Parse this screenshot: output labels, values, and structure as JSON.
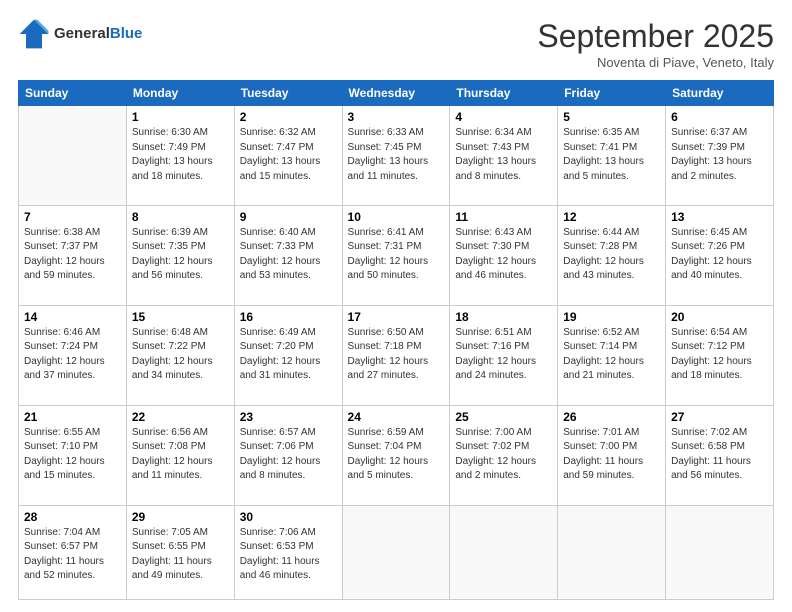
{
  "header": {
    "logo_line1": "General",
    "logo_line2": "Blue",
    "month": "September 2025",
    "location": "Noventa di Piave, Veneto, Italy"
  },
  "weekdays": [
    "Sunday",
    "Monday",
    "Tuesday",
    "Wednesday",
    "Thursday",
    "Friday",
    "Saturday"
  ],
  "weeks": [
    [
      {
        "day": "",
        "info": ""
      },
      {
        "day": "1",
        "info": "Sunrise: 6:30 AM\nSunset: 7:49 PM\nDaylight: 13 hours\nand 18 minutes."
      },
      {
        "day": "2",
        "info": "Sunrise: 6:32 AM\nSunset: 7:47 PM\nDaylight: 13 hours\nand 15 minutes."
      },
      {
        "day": "3",
        "info": "Sunrise: 6:33 AM\nSunset: 7:45 PM\nDaylight: 13 hours\nand 11 minutes."
      },
      {
        "day": "4",
        "info": "Sunrise: 6:34 AM\nSunset: 7:43 PM\nDaylight: 13 hours\nand 8 minutes."
      },
      {
        "day": "5",
        "info": "Sunrise: 6:35 AM\nSunset: 7:41 PM\nDaylight: 13 hours\nand 5 minutes."
      },
      {
        "day": "6",
        "info": "Sunrise: 6:37 AM\nSunset: 7:39 PM\nDaylight: 13 hours\nand 2 minutes."
      }
    ],
    [
      {
        "day": "7",
        "info": "Sunrise: 6:38 AM\nSunset: 7:37 PM\nDaylight: 12 hours\nand 59 minutes."
      },
      {
        "day": "8",
        "info": "Sunrise: 6:39 AM\nSunset: 7:35 PM\nDaylight: 12 hours\nand 56 minutes."
      },
      {
        "day": "9",
        "info": "Sunrise: 6:40 AM\nSunset: 7:33 PM\nDaylight: 12 hours\nand 53 minutes."
      },
      {
        "day": "10",
        "info": "Sunrise: 6:41 AM\nSunset: 7:31 PM\nDaylight: 12 hours\nand 50 minutes."
      },
      {
        "day": "11",
        "info": "Sunrise: 6:43 AM\nSunset: 7:30 PM\nDaylight: 12 hours\nand 46 minutes."
      },
      {
        "day": "12",
        "info": "Sunrise: 6:44 AM\nSunset: 7:28 PM\nDaylight: 12 hours\nand 43 minutes."
      },
      {
        "day": "13",
        "info": "Sunrise: 6:45 AM\nSunset: 7:26 PM\nDaylight: 12 hours\nand 40 minutes."
      }
    ],
    [
      {
        "day": "14",
        "info": "Sunrise: 6:46 AM\nSunset: 7:24 PM\nDaylight: 12 hours\nand 37 minutes."
      },
      {
        "day": "15",
        "info": "Sunrise: 6:48 AM\nSunset: 7:22 PM\nDaylight: 12 hours\nand 34 minutes."
      },
      {
        "day": "16",
        "info": "Sunrise: 6:49 AM\nSunset: 7:20 PM\nDaylight: 12 hours\nand 31 minutes."
      },
      {
        "day": "17",
        "info": "Sunrise: 6:50 AM\nSunset: 7:18 PM\nDaylight: 12 hours\nand 27 minutes."
      },
      {
        "day": "18",
        "info": "Sunrise: 6:51 AM\nSunset: 7:16 PM\nDaylight: 12 hours\nand 24 minutes."
      },
      {
        "day": "19",
        "info": "Sunrise: 6:52 AM\nSunset: 7:14 PM\nDaylight: 12 hours\nand 21 minutes."
      },
      {
        "day": "20",
        "info": "Sunrise: 6:54 AM\nSunset: 7:12 PM\nDaylight: 12 hours\nand 18 minutes."
      }
    ],
    [
      {
        "day": "21",
        "info": "Sunrise: 6:55 AM\nSunset: 7:10 PM\nDaylight: 12 hours\nand 15 minutes."
      },
      {
        "day": "22",
        "info": "Sunrise: 6:56 AM\nSunset: 7:08 PM\nDaylight: 12 hours\nand 11 minutes."
      },
      {
        "day": "23",
        "info": "Sunrise: 6:57 AM\nSunset: 7:06 PM\nDaylight: 12 hours\nand 8 minutes."
      },
      {
        "day": "24",
        "info": "Sunrise: 6:59 AM\nSunset: 7:04 PM\nDaylight: 12 hours\nand 5 minutes."
      },
      {
        "day": "25",
        "info": "Sunrise: 7:00 AM\nSunset: 7:02 PM\nDaylight: 12 hours\nand 2 minutes."
      },
      {
        "day": "26",
        "info": "Sunrise: 7:01 AM\nSunset: 7:00 PM\nDaylight: 11 hours\nand 59 minutes."
      },
      {
        "day": "27",
        "info": "Sunrise: 7:02 AM\nSunset: 6:58 PM\nDaylight: 11 hours\nand 56 minutes."
      }
    ],
    [
      {
        "day": "28",
        "info": "Sunrise: 7:04 AM\nSunset: 6:57 PM\nDaylight: 11 hours\nand 52 minutes."
      },
      {
        "day": "29",
        "info": "Sunrise: 7:05 AM\nSunset: 6:55 PM\nDaylight: 11 hours\nand 49 minutes."
      },
      {
        "day": "30",
        "info": "Sunrise: 7:06 AM\nSunset: 6:53 PM\nDaylight: 11 hours\nand 46 minutes."
      },
      {
        "day": "",
        "info": ""
      },
      {
        "day": "",
        "info": ""
      },
      {
        "day": "",
        "info": ""
      },
      {
        "day": "",
        "info": ""
      }
    ]
  ]
}
